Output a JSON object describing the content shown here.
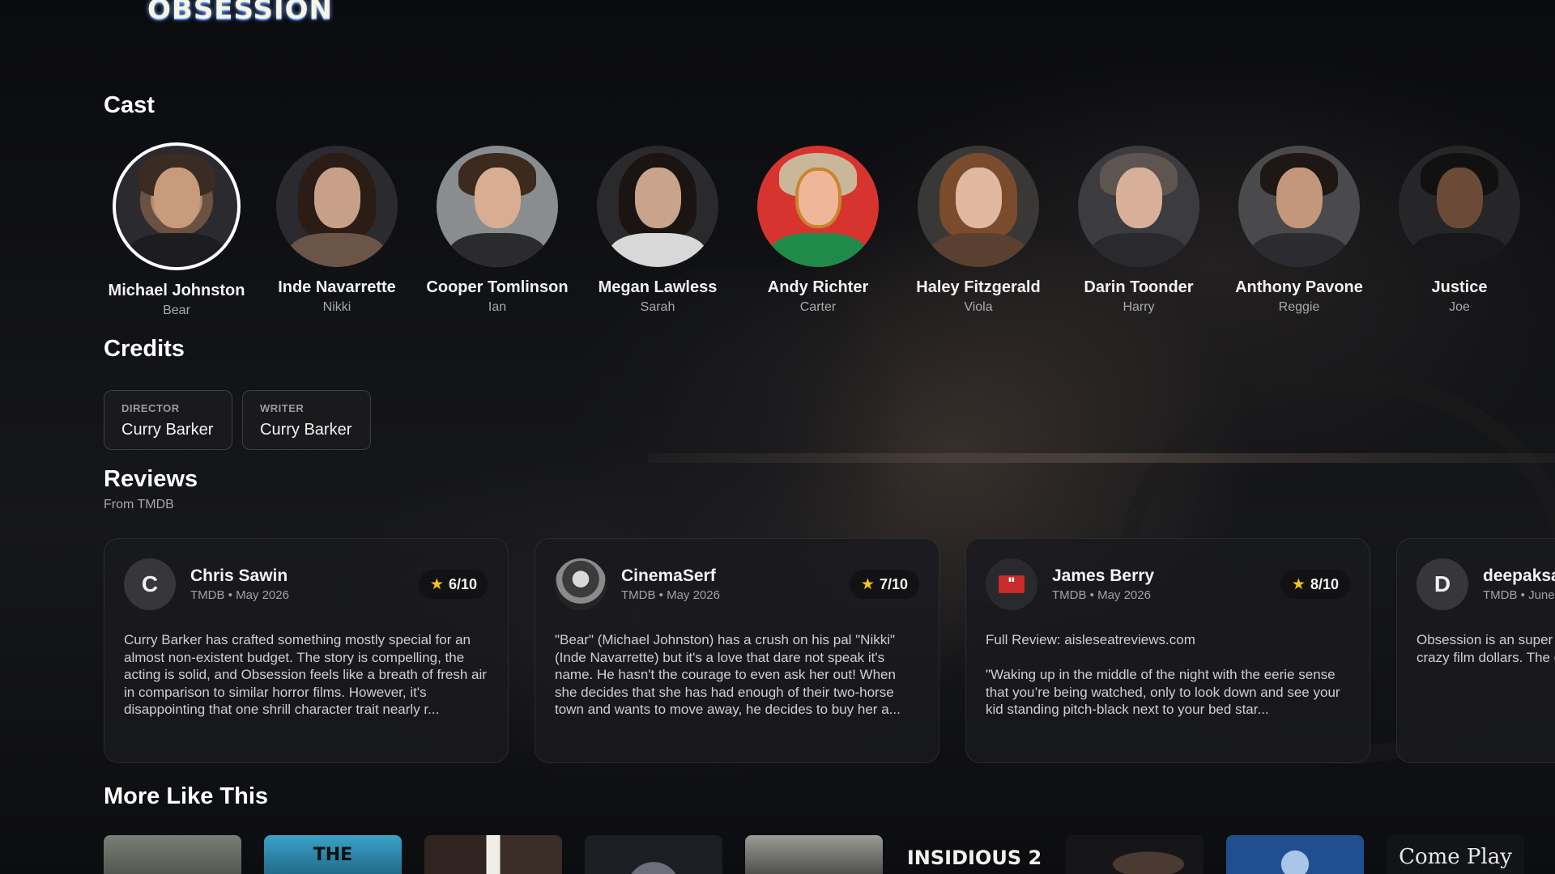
{
  "header": {
    "logo_text": "OBSESSION"
  },
  "cast": {
    "title": "Cast",
    "members": [
      {
        "name": "Michael Johnston",
        "role": "Bear",
        "selected": true
      },
      {
        "name": "Inde Navarrette",
        "role": "Nikki"
      },
      {
        "name": "Cooper Tomlinson",
        "role": "Ian"
      },
      {
        "name": "Megan Lawless",
        "role": "Sarah"
      },
      {
        "name": "Andy Richter",
        "role": "Carter"
      },
      {
        "name": "Haley Fitzgerald",
        "role": "Viola"
      },
      {
        "name": "Darin Toonder",
        "role": "Harry"
      },
      {
        "name": "Anthony Pavone",
        "role": "Reggie"
      },
      {
        "name": "Justice",
        "role": "Joe"
      }
    ]
  },
  "credits": {
    "title": "Credits",
    "items": [
      {
        "role": "DIRECTOR",
        "name": "Curry Barker"
      },
      {
        "role": "WRITER",
        "name": "Curry Barker"
      }
    ]
  },
  "reviews": {
    "title": "Reviews",
    "subtitle": "From TMDB",
    "rating_icon": "star-icon",
    "accent_color": "#f5c518",
    "items": [
      {
        "initial": "C",
        "author": "Chris Sawin",
        "source": "TMDB • May 2026",
        "rating": "6/10",
        "body": "Curry Barker has crafted something mostly special for an almost non-existent budget. The story is compelling, the acting is solid, and Obsession feels like a breath of fresh air in comparison to similar horror films. However, it's disappointing that one shrill character trait nearly r..."
      },
      {
        "initial": "",
        "author": "CinemaSerf",
        "source": "TMDB • May 2026",
        "rating": "7/10",
        "body": "\"Bear\" (Michael Johnston) has a crush on his pal \"Nikki\" (Inde Navarrette) but it's a love that dare not speak it's name. He hasn't the courage to even ask her out! When she decides that she has had enough of their two-horse town and wants to move away, he decides to buy her a..."
      },
      {
        "initial": "",
        "author": "James Berry",
        "source": "TMDB • May 2026",
        "rating": "8/10",
        "body": "Full Review: aisleseatreviews.com\n\n\"Waking up in the middle of the night with the eerie sense that you’re being watched, only to look down and see your kid standing pitch-black next to your bed star..."
      },
      {
        "initial": "D",
        "author": "deepaksa",
        "source": "TMDB • June",
        "rating": "",
        "body": "Obsession is an super directed by Curry Bar and what a crazy film dollars. The concept i at the same time that"
      }
    ]
  },
  "more_like_this": {
    "title": "More Like This",
    "posters": [
      {
        "label": "",
        "color": "#5f625c"
      },
      {
        "label": "THE",
        "color": "#2d7ea0"
      },
      {
        "label": "",
        "color": "#3a2f2a"
      },
      {
        "label": "",
        "color": "#25272e"
      },
      {
        "label": "",
        "color": "#6a6a68"
      },
      {
        "label": "INSIDIOUS 2",
        "color": "#0d0d10"
      },
      {
        "label": "",
        "color": "#1c1c1f"
      },
      {
        "label": "",
        "color": "#1f4f8f"
      },
      {
        "label": "Come Play",
        "color": "#121418"
      }
    ]
  }
}
